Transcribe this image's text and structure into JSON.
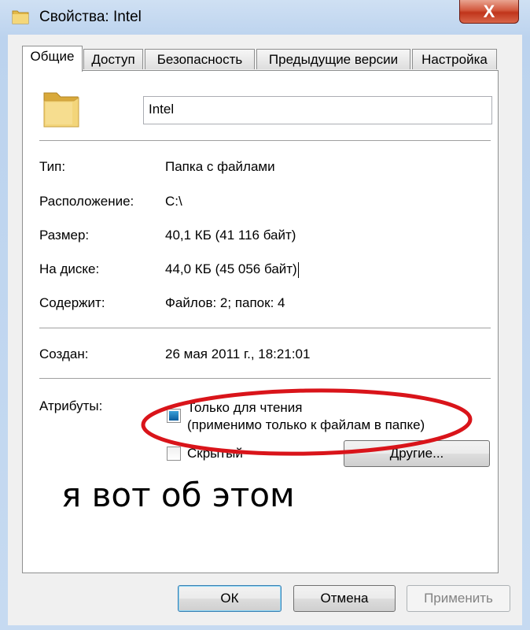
{
  "window": {
    "title": "Свойства: Intel",
    "close_glyph": "X"
  },
  "tabs": [
    {
      "label": "Общие",
      "active": true
    },
    {
      "label": "Доступ",
      "active": false
    },
    {
      "label": "Безопасность",
      "active": false
    },
    {
      "label": "Предыдущие версии",
      "active": false
    },
    {
      "label": "Настройка",
      "active": false
    }
  ],
  "general": {
    "folder_icon": "folder-icon",
    "name_value": "Intel",
    "rows": [
      {
        "label": "Тип:",
        "value": "Папка с файлами"
      },
      {
        "label": "Расположение:",
        "value": "C:\\"
      },
      {
        "label": "Размер:",
        "value": "40,1 КБ (41 116 байт)"
      },
      {
        "label": "На диске:",
        "value": "44,0 КБ (45 056 байт)"
      },
      {
        "label": "Содержит:",
        "value": "Файлов: 2; папок: 4"
      }
    ],
    "created_label": "Создан:",
    "created_value": "26 мая 2011 г., 18:21:01",
    "attributes_label": "Атрибуты:",
    "readonly_line1": "Только для чтения",
    "readonly_line2": "(применимо только к файлам в папке)",
    "hidden_label": "Скрытый",
    "other_button": "Другие..."
  },
  "annotation": {
    "text": "я вот об этом",
    "ellipse_color": "#d9141a"
  },
  "buttons": {
    "ok": "ОК",
    "cancel": "Отмена",
    "apply": "Применить"
  },
  "colors": {
    "close_button": "#c0341b",
    "checkbox_fill": "#0b5d9e",
    "titlebar": "#c6daf1"
  }
}
